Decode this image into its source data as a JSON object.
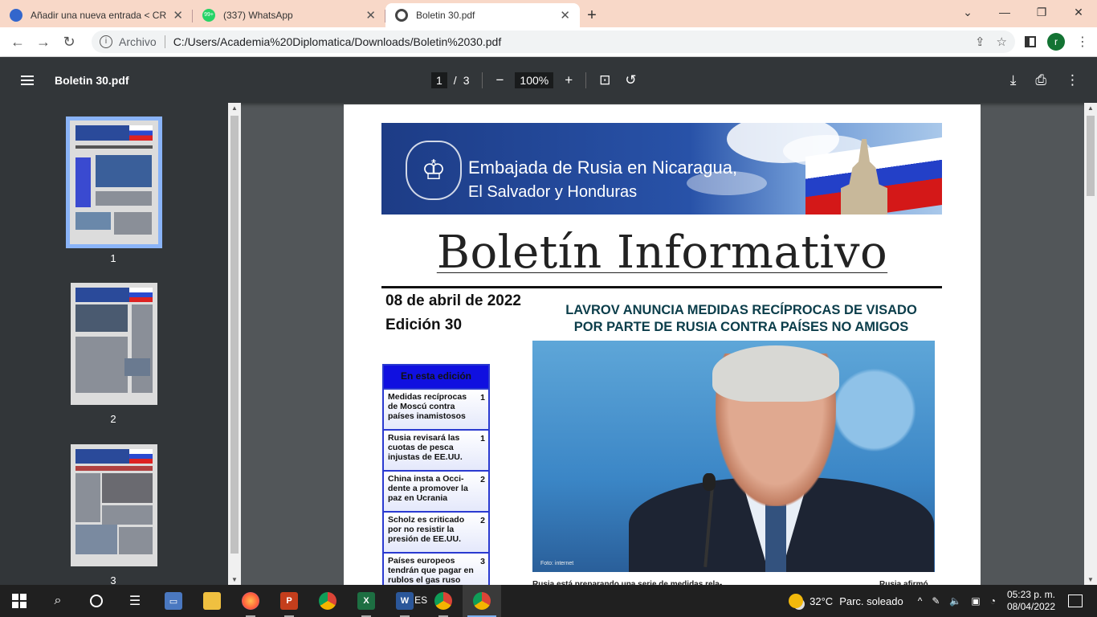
{
  "browser": {
    "tabs": [
      {
        "title": "Añadir una nueva entrada < CREI",
        "favicon_color": "#3366cc",
        "active": false
      },
      {
        "title": "(337) WhatsApp",
        "favicon_color": "#25d366",
        "favicon_badge": "99+",
        "active": false
      },
      {
        "title": "Boletin 30.pdf",
        "favicon_color": "#444444",
        "active": true
      }
    ],
    "new_tab_label": "+",
    "window_controls": {
      "chevron": "⌄",
      "minimize": "—",
      "restore": "❐",
      "close": "✕"
    },
    "address": {
      "scheme_label": "Archivo",
      "url": "C:/Users/Academia%20Diplomatica/Downloads/Boletin%2030.pdf",
      "info_icon": "i"
    },
    "profile_initial": "r"
  },
  "pdf_viewer": {
    "title": "Boletin 30.pdf",
    "current_page": "1",
    "page_separator": "/",
    "total_pages": "3",
    "zoom": "100%",
    "thumbnails": [
      {
        "label": "1",
        "selected": true
      },
      {
        "label": "2",
        "selected": false
      },
      {
        "label": "3",
        "selected": false
      }
    ]
  },
  "document": {
    "banner_line1": "Embajada de Rusia en Nicaragua,",
    "banner_line2": "El Salvador y Honduras",
    "main_title": "Boletín Informativo",
    "date": "08 de abril de 2022",
    "edition": "Edición 30",
    "headline_line1": "LAVROV ANUNCIA MEDIDAS RECÍPROCAS DE VISADO",
    "headline_line2": "POR PARTE DE RUSIA CONTRA PAÍSES NO AMIGOS",
    "photo_credit": "Foto: internet",
    "toc_title": "En esta edición",
    "toc": [
      {
        "text": "Medidas recíprocas de Moscú contra países inamistosos",
        "page": "1"
      },
      {
        "text": "Rusia revisará las cuotas de pesca injustas de EE.UU.",
        "page": "1"
      },
      {
        "text": "China insta a Occi-dente a promover la paz en Ucrania",
        "page": "2"
      },
      {
        "text": "Scholz es criticado por no resistir la presión de EE.UU.",
        "page": "2"
      },
      {
        "text": "Países europeos tendrán que pagar en rublos el gas ruso",
        "page": "3"
      }
    ],
    "body_start": "Rusia está preparando una serie de medidas rela-",
    "body_right": "Rusia afirmó"
  },
  "taskbar": {
    "language": "ES",
    "temperature": "32°C",
    "weather": "Parc. soleado",
    "time": "05:23 p. m.",
    "date": "08/04/2022",
    "apps": [
      {
        "name": "start",
        "icon": "windows-logo-icon"
      },
      {
        "name": "search",
        "icon": "search-icon"
      },
      {
        "name": "cortana",
        "icon": "circle-icon"
      },
      {
        "name": "task-view",
        "icon": "task-view-icon"
      },
      {
        "name": "remote-desktop",
        "icon": "monitor-icon"
      },
      {
        "name": "file-explorer",
        "icon": "folder-icon"
      },
      {
        "name": "firefox",
        "icon": "firefox-icon"
      },
      {
        "name": "powerpoint",
        "icon": "powerpoint-icon",
        "letter": "P"
      },
      {
        "name": "chrome",
        "icon": "chrome-icon"
      },
      {
        "name": "excel",
        "icon": "excel-icon",
        "letter": "X"
      },
      {
        "name": "word",
        "icon": "word-icon",
        "letter": "W"
      },
      {
        "name": "chrome-2",
        "icon": "chrome-icon"
      },
      {
        "name": "chrome-profile",
        "icon": "chrome-icon"
      }
    ]
  },
  "colors": {
    "tabstrip": "#f8d8c8",
    "pdf_toolbar": "#323639",
    "headline": "#0b3d4a",
    "toc_border": "#2a3ad0",
    "toc_head": "#1010e0"
  }
}
